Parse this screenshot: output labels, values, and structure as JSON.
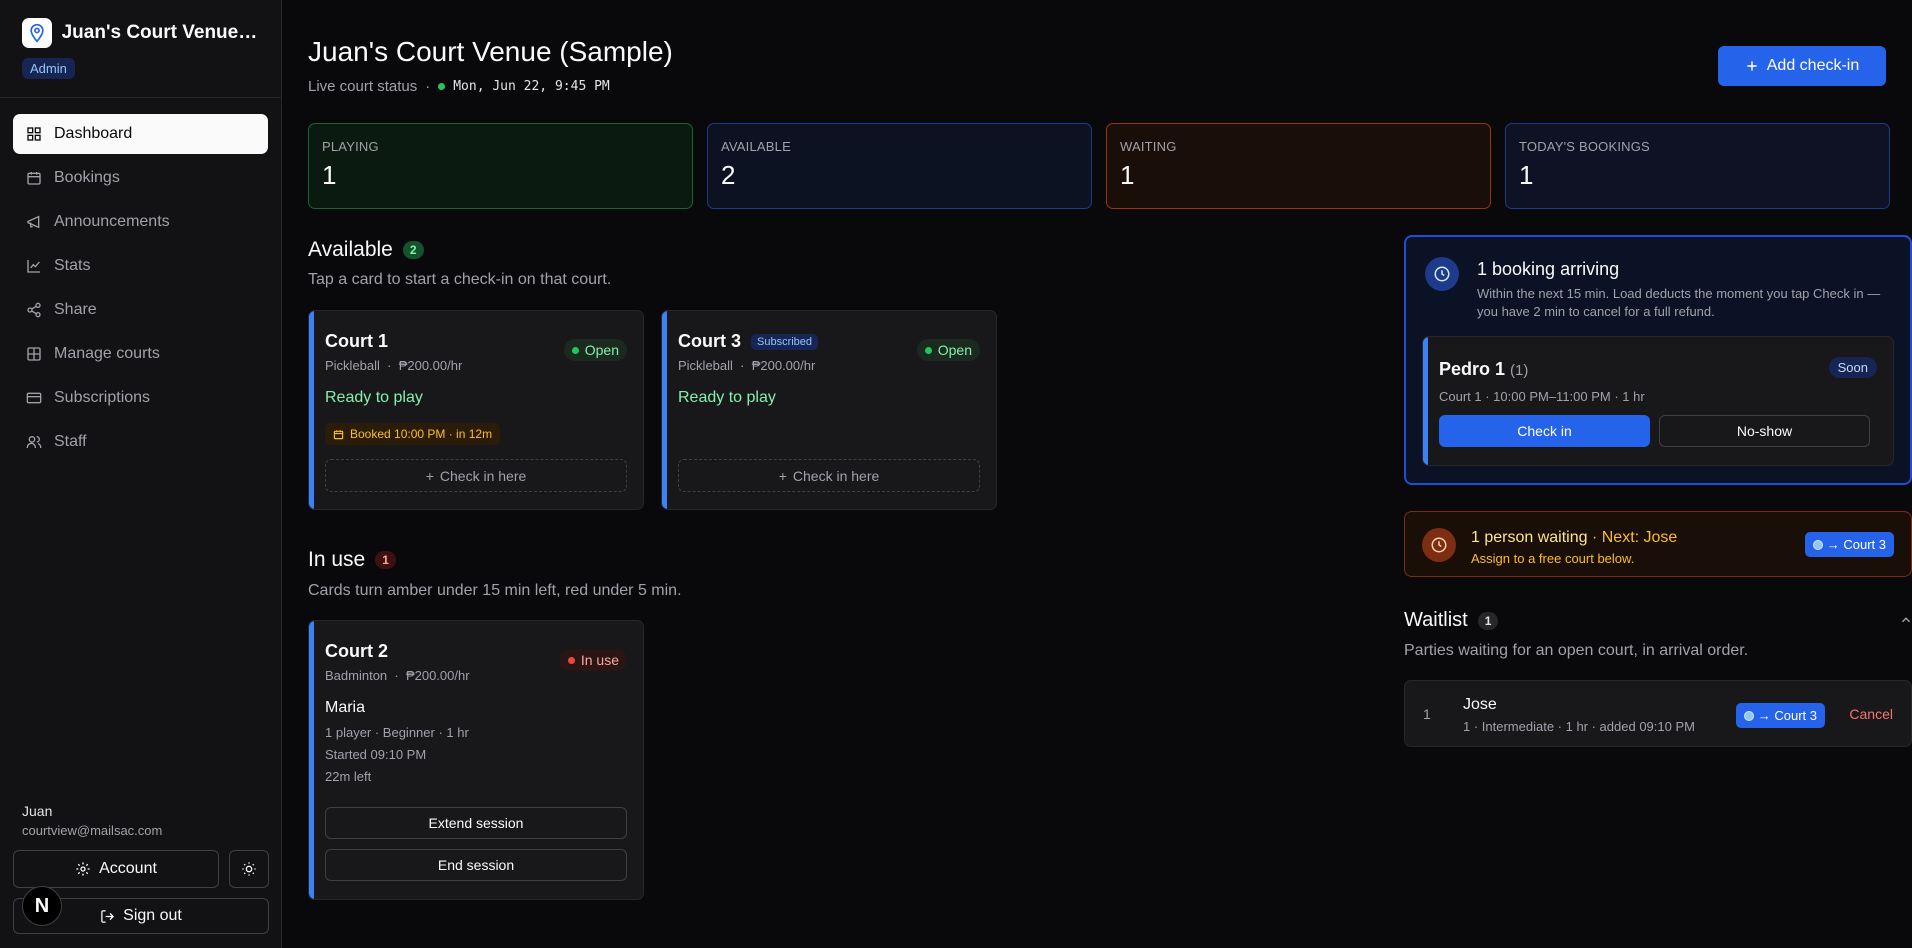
{
  "sidebar": {
    "venue_name": "Juan's Court Venue (Sample)",
    "role": "Admin",
    "nav": [
      {
        "label": "Dashboard",
        "icon": "dashboard-icon"
      },
      {
        "label": "Bookings",
        "icon": "calendar-icon"
      },
      {
        "label": "Announcements",
        "icon": "megaphone-icon"
      },
      {
        "label": "Stats",
        "icon": "chart-icon"
      },
      {
        "label": "Share",
        "icon": "share-icon"
      },
      {
        "label": "Manage courts",
        "icon": "grid-icon"
      },
      {
        "label": "Subscriptions",
        "icon": "card-icon"
      },
      {
        "label": "Staff",
        "icon": "users-icon"
      }
    ],
    "user": {
      "name": "Juan",
      "email": "courtview@mailsac.com"
    },
    "account_label": "Account",
    "signout_label": "Sign out",
    "n_badge": "N"
  },
  "header": {
    "title": "Juan's Court Venue (Sample)",
    "subtitle": "Live court status",
    "separator": "·",
    "datetime": "Mon, Jun 22, 9:45 PM",
    "add_checkin": "Add check-in"
  },
  "stats": [
    {
      "label": "PLAYING",
      "value": "1"
    },
    {
      "label": "AVAILABLE",
      "value": "2"
    },
    {
      "label": "WAITING",
      "value": "1"
    },
    {
      "label": "TODAY'S BOOKINGS",
      "value": "1"
    }
  ],
  "available": {
    "title": "Available",
    "count": "2",
    "desc": "Tap a card to start a check-in on that court.",
    "courts": [
      {
        "name": "Court 1",
        "sport": "Pickleball",
        "rate": "₱200.00/hr",
        "status": "Open",
        "ready": "Ready to play",
        "booked": "Booked 10:00 PM · in 12m",
        "checkin": "Check in here"
      },
      {
        "name": "Court 3",
        "badge": "Subscribed",
        "sport": "Pickleball",
        "rate": "₱200.00/hr",
        "status": "Open",
        "ready": "Ready to play",
        "checkin": "Check in here"
      }
    ]
  },
  "in_use": {
    "title": "In use",
    "count": "1",
    "desc": "Cards turn amber under 15 min left, red under 5 min.",
    "court": {
      "name": "Court 2",
      "sport": "Badminton",
      "rate": "₱200.00/hr",
      "status": "In use",
      "player": "Maria",
      "details": "1 player · Beginner · 1 hr",
      "started": "Started 09:10 PM",
      "left": "22m left",
      "extend": "Extend session",
      "end": "End session"
    }
  },
  "arriving": {
    "title": "1 booking arriving",
    "desc": "Within the next 15 min. Load deducts the moment you tap Check in — you have 2 min to cancel for a full refund.",
    "booking": {
      "name": "Pedro 1",
      "party": "(1)",
      "meta": "Court 1 · 10:00 PM–11:00 PM · 1 hr",
      "badge": "Soon",
      "checkin": "Check in",
      "noshow": "No-show"
    }
  },
  "waiting_banner": {
    "title": "1 person waiting",
    "next": " · Next: Jose",
    "desc": "Assign to a free court below.",
    "chip": "→ Court 3"
  },
  "waitlist": {
    "title": "Waitlist",
    "count": "1",
    "desc": "Parties waiting for an open court, in arrival order.",
    "rows": [
      {
        "index": "1",
        "name": "Jose",
        "meta": "1 · Intermediate · 1 hr · added 09:10 PM",
        "chip": "→ Court 3",
        "cancel": "Cancel"
      }
    ]
  },
  "colors": {
    "accent": "#2563eb",
    "open": "#22c55e",
    "in_use": "#ef4444",
    "waiting": "#f59e0b"
  }
}
